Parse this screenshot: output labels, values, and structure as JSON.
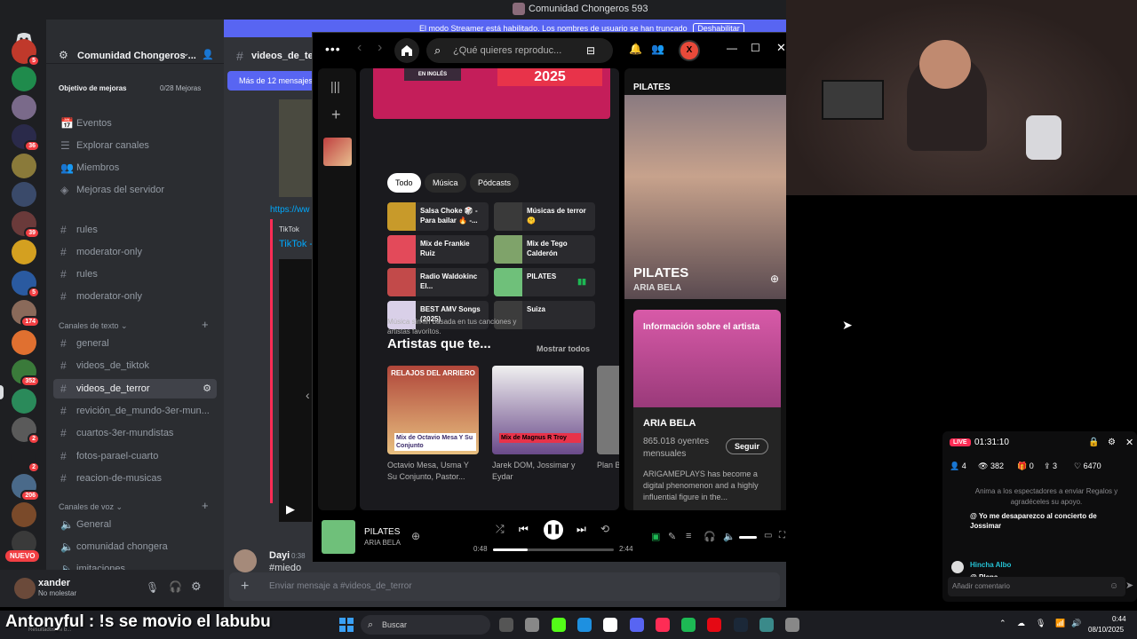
{
  "window_title": "Comunidad Chongeros 593",
  "streamer_banner": {
    "text": "El modo Streamer está habilitado. Los nombres de usuario se han truncado",
    "button": "Deshabilitar"
  },
  "discord": {
    "server_name": "Comunidad Chongeros ...",
    "goal": {
      "label": "Objetivo de mejoras",
      "progress": "0/28 Mejoras"
    },
    "top_items": [
      {
        "label": "Eventos",
        "icon": "calendar-icon"
      },
      {
        "label": "Explorar canales",
        "icon": "list-icon"
      },
      {
        "label": "Miembros",
        "icon": "members-icon"
      },
      {
        "label": "Mejoras del servidor",
        "icon": "boost-icon"
      }
    ],
    "channels_a": [
      "rules",
      "moderator-only",
      "rules",
      "moderator-only"
    ],
    "text_category": "Canales de texto",
    "text_channels": [
      "general",
      "videos_de_tiktok",
      "videos_de_terror",
      "revición_de_mundo-3er-mun...",
      "cuartos-3er-mundistas",
      "fotos-parael-cuarto",
      "reacion-de-musicas"
    ],
    "voice_category": "Canales de voz",
    "voice_channels": [
      "General",
      "comunidad chongera",
      "imitaciones"
    ],
    "server_badges": [
      "5",
      "",
      "",
      "36",
      "",
      "",
      "39",
      "",
      "5",
      "174",
      "",
      "352",
      "",
      "2",
      "2",
      "206",
      "",
      ""
    ],
    "nuevo": "NUEVO",
    "user": {
      "name": "xander",
      "status": "No molestar"
    },
    "channel_header": "videos_de_terror",
    "new_messages": "Más de 12 mensajes",
    "link_text": "https://ww",
    "tiktok_label": "TikTok",
    "tiktok_link": "TikTok -",
    "message_author": "Dayi",
    "message_time": "0:38",
    "message_text": "#miedo",
    "input_placeholder": "Enviar mensaje a #videos_de_terror"
  },
  "spotify": {
    "search_placeholder": "¿Qué quieres reproduc...",
    "profile_initial": "X",
    "banner_tags": [
      "EN INGLÉS",
      "2025"
    ],
    "chips": [
      "Todo",
      "Música",
      "Pódcasts"
    ],
    "tiles": [
      {
        "title": "Salsa Choke 🎲 - Para bailar 🔥 -...",
        "color": "#c89a2a"
      },
      {
        "title": "Músicas de terror 🤫",
        "color": "#3a3a3a"
      },
      {
        "title": "Mix de Frankie Ruiz",
        "color": "#e34a5a"
      },
      {
        "title": "Mix de Tego Calderón",
        "color": "#7fa36a"
      },
      {
        "title": "Radio Waldokinc El...",
        "color": "#c24a4a"
      },
      {
        "title": "PILATES",
        "color": "#6fc07a"
      },
      {
        "title": "BEST AMV Songs (2025)",
        "color": "#d9d0e8"
      },
      {
        "title": "Suiza",
        "color": "#3c3c3c"
      }
    ],
    "section_sub": "Música sin fin basada en tus canciones y artistas favoritos.",
    "section_title": "Artistas que te...",
    "show_all": "Mostrar todos",
    "cards": [
      {
        "title": "Octavio Mesa, Usma Y Su Conjunto, Pastor...",
        "cover_text": "RELAJOS DEL ARRIERO",
        "mix": "Mix de Octavio Mesa Y Su Conjunto"
      },
      {
        "title": "Jarek DOM, Jossimar y Eydar",
        "mix": "Mix de Magnus R Troy"
      },
      {
        "title": "Plan B, Frank..."
      }
    ],
    "now_playing_header": "PILATES",
    "now_playing_title": "PILATES",
    "now_playing_artist": "ARIA BELA",
    "artist_info_label": "Información sobre el artista",
    "artist_name": "ARIA BELA",
    "listeners": "865.018 oyentes mensuales",
    "follow": "Seguir",
    "artist_bio": "ARIGAMEPLAYS has become a digital phenomenon and a highly influential figure in the...",
    "player": {
      "title": "PILATES",
      "artist": "ARIA BELA",
      "elapsed": "0:48",
      "total": "2:44",
      "progress": 0.29
    }
  },
  "live_panel": {
    "live_label": "LIVE",
    "timer": "01:31:10",
    "stats": [
      "4",
      "382",
      "0",
      "3",
      "6470"
    ],
    "hint": "Anima a los espectadores a enviar Regalos y agradéceles su apoyo.",
    "chat": [
      {
        "user": "",
        "text": "@ Yo me desaparezco al concierto de Jossimar"
      },
      {
        "user": "Hincha Albo",
        "text": "@ Plena"
      }
    ],
    "comment_placeholder": "Añadir comentario"
  },
  "marquee": "Antonyful : !s se movio el labubu",
  "taskbar": {
    "search": "Buscar",
    "time": "0:44",
    "date": "08/10/2025",
    "lower_text": "Resultados de b..."
  },
  "colors": {
    "discord_blurple": "#5865f2",
    "spotify_green": "#1db954",
    "tiktok_red": "#fe2c55"
  }
}
